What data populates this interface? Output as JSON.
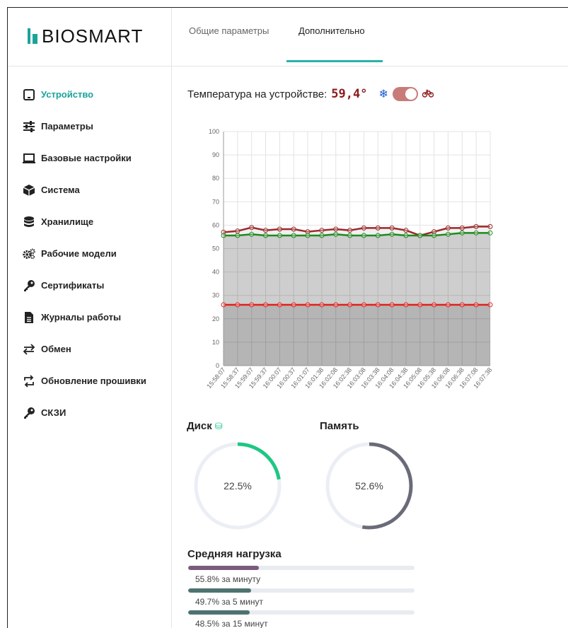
{
  "logo": "BIOSMART",
  "tabs": [
    {
      "label": "Общие параметры"
    },
    {
      "label": "Дополнительно",
      "active": true
    }
  ],
  "menu": [
    {
      "label": "Устройство",
      "icon": "tablet-icon",
      "active": true
    },
    {
      "label": "Параметры",
      "icon": "sliders-icon"
    },
    {
      "label": "Базовые настройки",
      "icon": "laptop-icon"
    },
    {
      "label": "Система",
      "icon": "cube-icon"
    },
    {
      "label": "Хранилище",
      "icon": "database-icon"
    },
    {
      "label": "Рабочие модели",
      "icon": "gears-icon"
    },
    {
      "label": "Сертификаты",
      "icon": "key-icon"
    },
    {
      "label": "Журналы работы",
      "icon": "file-icon"
    },
    {
      "label": "Обмен",
      "icon": "exchange-icon"
    },
    {
      "label": "Обновление прошивки",
      "icon": "refresh-icon"
    },
    {
      "label": "СКЗИ",
      "icon": "key-icon"
    }
  ],
  "temperature": {
    "label": "Температура на устройстве:",
    "value": "59,4°"
  },
  "chart_data": {
    "type": "line",
    "x": [
      "15:58:07",
      "15:58:37",
      "15:59:07",
      "15:59:37",
      "16:00:07",
      "16:00:37",
      "16:01:07",
      "16:01:38",
      "16:02:08",
      "16:02:38",
      "16:03:08",
      "16:03:38",
      "16:04:08",
      "16:04:38",
      "16:05:08",
      "16:05:38",
      "16:06:08",
      "16:06:38",
      "16:07:08",
      "16:07:38"
    ],
    "ylim": [
      0,
      100
    ],
    "yticks": [
      0,
      10,
      20,
      30,
      40,
      50,
      60,
      70,
      80,
      90,
      100
    ],
    "series": [
      {
        "color": "#9b2a2a",
        "values": [
          57,
          57.5,
          59,
          57.8,
          58.3,
          58.3,
          57.2,
          57.8,
          58.3,
          57.8,
          58.8,
          58.8,
          58.8,
          57.8,
          55.6,
          57.2,
          58.8,
          58.8,
          59.4,
          59.4
        ]
      },
      {
        "color": "#1e8a1e",
        "values": [
          55.6,
          55.6,
          56.1,
          55.6,
          55.6,
          55.6,
          55.6,
          55.6,
          56.1,
          55.6,
          55.6,
          55.6,
          56.1,
          55.6,
          55.6,
          55.6,
          56.1,
          56.7,
          56.7,
          56.7
        ]
      },
      {
        "color": "#e02020",
        "values": [
          26,
          26,
          26,
          26,
          26,
          26,
          26,
          26,
          26,
          26,
          26,
          26,
          26,
          26,
          26,
          26,
          26,
          26,
          26,
          26
        ]
      }
    ],
    "grid": true
  },
  "disk": {
    "title": "Диск",
    "value": 22.5,
    "label": "22.5%",
    "color": "#1ec783"
  },
  "memory": {
    "title": "Память",
    "value": 52.6,
    "label": "52.6%",
    "color": "#6a6b78"
  },
  "load": {
    "title": "Средняя нагрузка",
    "items": [
      {
        "value": 55.8,
        "label": "55.8% за минуту",
        "color": "#7a5b7d"
      },
      {
        "value": 49.7,
        "label": "49.7% за 5 минут",
        "color": "#4e7371"
      },
      {
        "value": 48.5,
        "label": "48.5% за 15 минут",
        "color": "#4e7371"
      }
    ]
  }
}
